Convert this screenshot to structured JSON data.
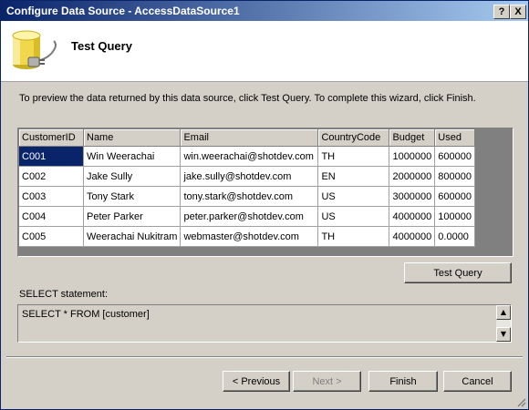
{
  "window": {
    "title": "Configure Data Source - AccessDataSource1",
    "help_label": "?",
    "close_label": "X"
  },
  "header": {
    "heading": "Test Query",
    "icon": "database-plug-icon"
  },
  "instructions": "To preview the data returned by this data source, click Test Query. To complete this wizard, click Finish.",
  "grid": {
    "columns": [
      "CustomerID",
      "Name",
      "Email",
      "CountryCode",
      "Budget",
      "Used"
    ],
    "rows": [
      [
        "C001",
        "Win Weerachai",
        "win.weerachai@shotdev.com",
        "TH",
        "1000000",
        "600000"
      ],
      [
        "C002",
        "Jake Sully",
        "jake.sully@shotdev.com",
        "EN",
        "2000000",
        "800000"
      ],
      [
        "C003",
        "Tony Stark",
        "tony.stark@shotdev.com",
        "US",
        "3000000",
        "600000"
      ],
      [
        "C004",
        "Peter Parker",
        "peter.parker@shotdev.com",
        "US",
        "4000000",
        "100000"
      ],
      [
        "C005",
        "Weerachai Nukitram",
        "webmaster@shotdev.com",
        "TH",
        "4000000",
        "0.0000"
      ]
    ]
  },
  "test_query_label": "Test Query",
  "select_statement": {
    "label": "SELECT statement:",
    "value": "SELECT * FROM [customer]"
  },
  "buttons": {
    "previous": "< Previous",
    "next": "Next >",
    "finish": "Finish",
    "cancel": "Cancel"
  },
  "colors": {
    "title_start": "#0a246a",
    "title_end": "#a6caf0",
    "selection": "#0a246a",
    "face": "#d4d0c8"
  }
}
